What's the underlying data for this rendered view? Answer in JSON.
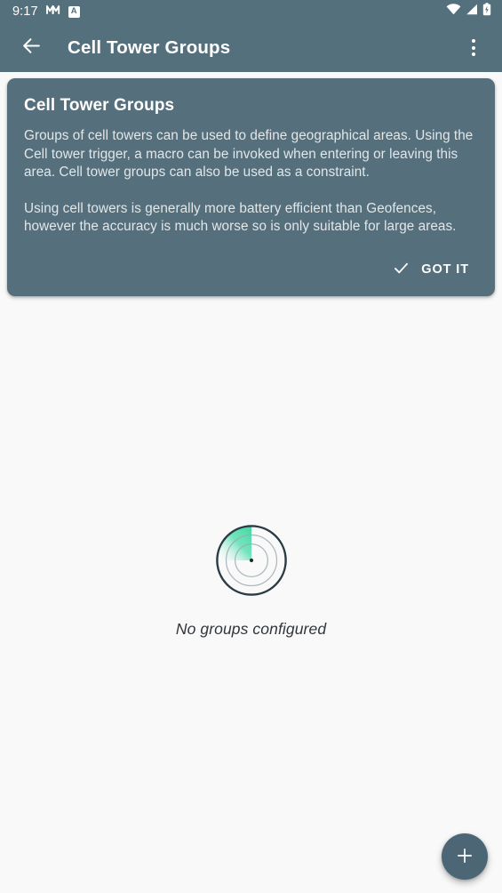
{
  "status_bar": {
    "clock": "9:17",
    "notification_icon": "macrodroid-m-icon",
    "badge_icon_letter": "A",
    "wifi_icon": "wifi-icon",
    "signal_icon": "cellular-signal-icon",
    "battery_icon": "battery-charging-icon"
  },
  "app_bar": {
    "back_icon": "arrow-left-icon",
    "title": "Cell Tower Groups",
    "overflow_icon": "more-vertical-icon"
  },
  "info_card": {
    "title": "Cell Tower Groups",
    "paragraph_1": "Groups of cell towers can be used to define geographical areas. Using the Cell tower trigger, a macro can be invoked when entering or leaving this area. Cell tower groups can also be used as a constraint.",
    "paragraph_2": "Using cell towers is generally more battery efficient than Geofences, however the accuracy is much worse so is only suitable for large areas.",
    "dismiss_icon": "check-icon",
    "dismiss_label": "GOT IT"
  },
  "empty_state": {
    "icon": "radar-sweep-icon",
    "message": "No groups configured"
  },
  "fab": {
    "icon": "plus-icon",
    "label": "+"
  },
  "colors": {
    "app_bar": "#54707d",
    "card": "#556f7c",
    "page_background": "#f9f9fa",
    "fab": "#4d6675",
    "radar_accent": "#3fd9a2",
    "radar_ring": "#2a3b44",
    "text_primary": "#ffffff",
    "text_body": "#e2e7e9",
    "text_empty": "#31363a"
  }
}
